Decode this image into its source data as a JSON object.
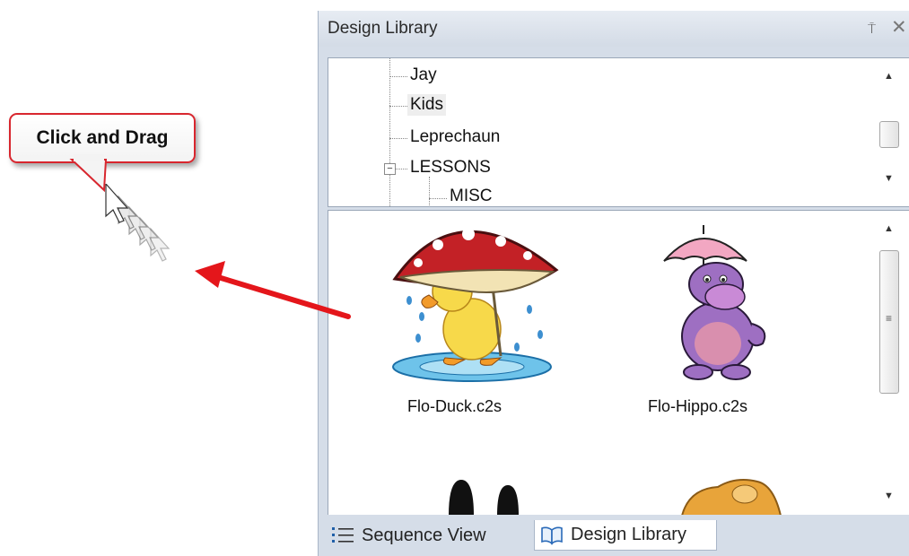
{
  "callout": {
    "text": "Click and Drag"
  },
  "panel": {
    "title": "Design Library",
    "pin_glyph": "⍑",
    "close_glyph": "✕",
    "tree": {
      "items": [
        {
          "label": "Jay",
          "selected": false
        },
        {
          "label": "Kids",
          "selected": true
        },
        {
          "label": "Leprechaun",
          "selected": false
        },
        {
          "label": "LESSONS",
          "selected": false,
          "expanded": true
        },
        {
          "label": "MISC",
          "selected": false
        }
      ],
      "expander_glyph": "−"
    },
    "designs": [
      {
        "filename": "Flo-Duck.c2s",
        "icon": "duck-under-mushroom-icon"
      },
      {
        "filename": "Flo-Hippo.c2s",
        "icon": "hippo-with-umbrella-icon"
      }
    ],
    "tabs": [
      {
        "label": "Sequence View",
        "icon": "list-icon",
        "active": false
      },
      {
        "label": "Design Library",
        "icon": "book-icon",
        "active": true
      }
    ]
  },
  "colors": {
    "callout_border": "#d8262e",
    "arrow": "#e4161b",
    "panel_bg": "#d5dde8"
  }
}
